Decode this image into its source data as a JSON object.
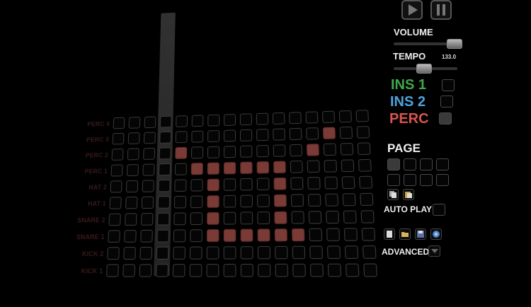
{
  "rows": [
    {
      "label": "PERC 4",
      "on": []
    },
    {
      "label": "PERC 3",
      "on": [
        13
      ]
    },
    {
      "label": "PERC 2",
      "on": [
        4,
        12
      ]
    },
    {
      "label": "PERC 1",
      "on": [
        5,
        6,
        7,
        8,
        9,
        10
      ]
    },
    {
      "label": "HAT 2",
      "on": [
        6,
        10
      ]
    },
    {
      "label": "HAT 1",
      "on": [
        6,
        10
      ]
    },
    {
      "label": "SNARE 2",
      "on": [
        6,
        10
      ]
    },
    {
      "label": "SNARE 1",
      "on": [
        6,
        7,
        8,
        9,
        10,
        11
      ]
    },
    {
      "label": "KICK 2",
      "on": []
    },
    {
      "label": "KICK 1",
      "on": []
    }
  ],
  "playhead_step": 3,
  "panel": {
    "volume_label": "VOLUME",
    "volume_level": 0.92,
    "tempo_label": "TEMPO",
    "tempo_value": "133.0",
    "tempo_level": 0.47,
    "ins1_label": "INS 1",
    "ins2_label": "INS 2",
    "perc_label": "PERC",
    "page_label": "PAGE",
    "auto_play_label": "AUTO PLAY",
    "advanced_label": "ADVANCED"
  },
  "colors": {
    "ins1": "#3fa84a",
    "ins2": "#4ea3dc",
    "perc": "#d9544f",
    "active_cell": "#7a3a35"
  },
  "icons": [
    "play-icon",
    "pause-icon",
    "copy-icon",
    "paste-icon",
    "new-file-icon",
    "open-folder-icon",
    "save-icon",
    "share-icon",
    "dropdown-arrow-icon"
  ]
}
